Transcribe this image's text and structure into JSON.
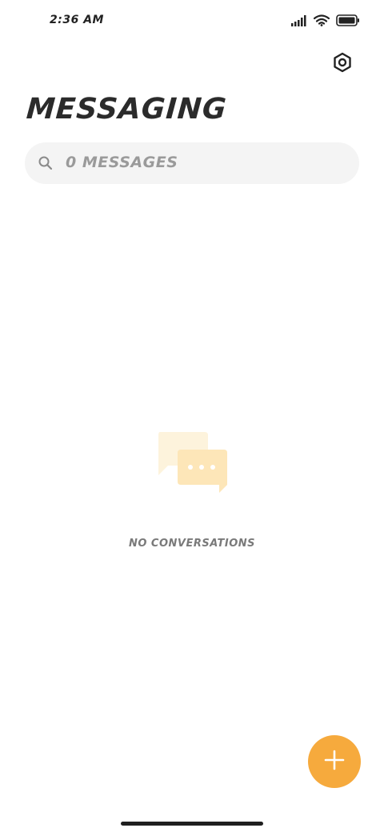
{
  "status_bar": {
    "time": "2:36 AM",
    "icons": [
      "signal-icon",
      "wifi-icon",
      "battery-icon"
    ]
  },
  "header": {
    "title": "MESSAGING",
    "settings_icon": "settings-hexagon-icon"
  },
  "search": {
    "placeholder": "0 MESSAGES",
    "icon": "search-icon"
  },
  "empty_state": {
    "icon": "chat-bubbles-icon",
    "message": "NO CONVERSATIONS"
  },
  "fab": {
    "icon": "plus-icon"
  },
  "colors": {
    "accent": "#f6aa3d",
    "illustration_light": "#fdf3dc",
    "illustration_dark": "#fde6b8",
    "search_bg": "#f4f4f4",
    "title": "#2b2b2b",
    "muted_text": "#9a9a9a"
  }
}
